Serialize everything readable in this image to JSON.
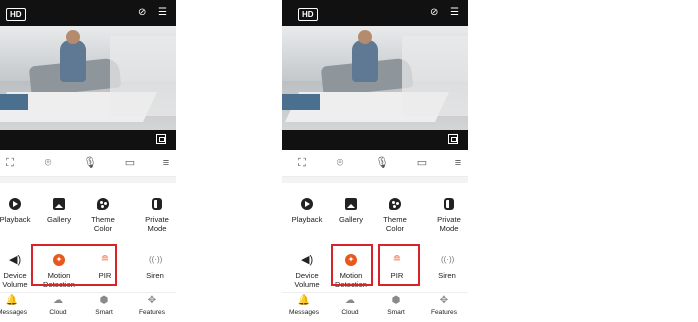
{
  "top": {
    "hd_label": "HD"
  },
  "icons": {
    "mute": "mute-icon",
    "menu": "menu-icon",
    "fullscreen": "fullscreen-icon",
    "screenshot": "camera-icon",
    "mic": "microphone-icon",
    "record": "record-icon",
    "more": "more-menu-icon"
  },
  "features": [
    {
      "label": "Playback",
      "icon": "play-icon"
    },
    {
      "label": "Gallery",
      "icon": "gallery-icon"
    },
    {
      "label": "Theme Color",
      "icon": "palette-icon"
    },
    {
      "label": "Private Mode",
      "icon": "privacy-icon"
    },
    {
      "label": "Device Volume",
      "icon": "speaker-icon"
    },
    {
      "label": "Motion Detection",
      "icon": "motion-icon"
    },
    {
      "label": "PIR",
      "icon": "pir-icon"
    },
    {
      "label": "Siren",
      "icon": "siren-icon"
    }
  ],
  "nav": [
    {
      "label": "Messages",
      "icon": "bell-icon"
    },
    {
      "label": "Cloud",
      "icon": "cloud-icon"
    },
    {
      "label": "Smart",
      "icon": "smart-icon"
    },
    {
      "label": "Features",
      "icon": "features-icon"
    }
  ],
  "highlight_color": "#d9232b",
  "accent_color": "#e8581c"
}
